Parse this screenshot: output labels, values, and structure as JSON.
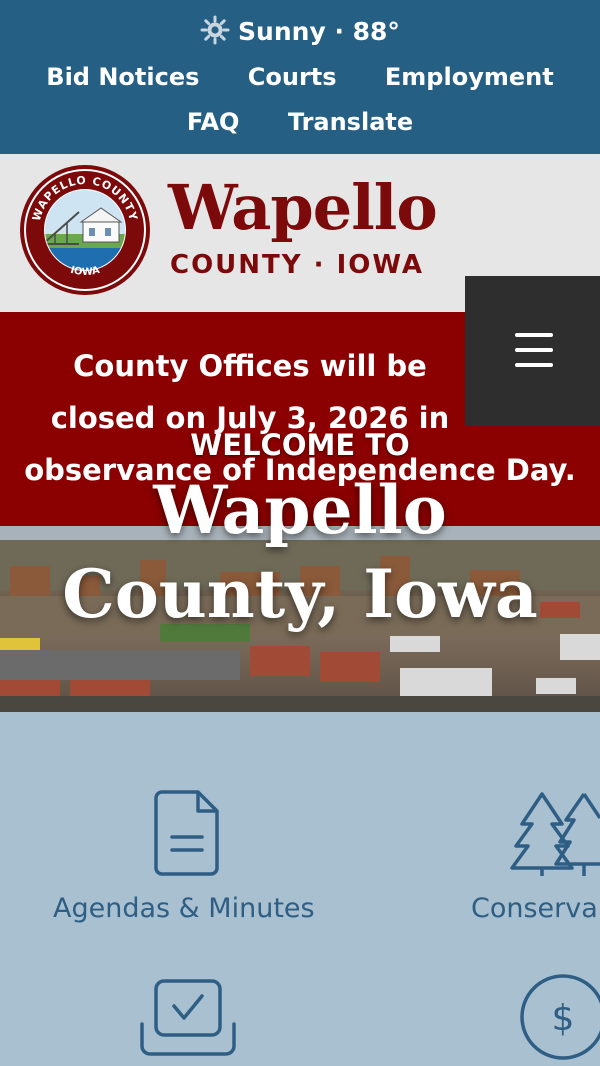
{
  "utility": {
    "weather": "Sunny · 88°",
    "weather_icon": "sun-icon",
    "links": [
      "Bid Notices",
      "Courts",
      "Employment",
      "FAQ",
      "Translate"
    ]
  },
  "brand": {
    "seal_top_text": "WAPELLO COUNTY",
    "seal_bottom_text": "IOWA",
    "name": "Wapello",
    "subtitle": "COUNTY · IOWA"
  },
  "menu": {
    "icon": "hamburger-menu-icon"
  },
  "alert": {
    "line1": "County Offices will be",
    "line2": "closed on July 3, 2026 in",
    "line3": "observance of Independence Day."
  },
  "hero": {
    "kicker": "WELCOME TO",
    "title_line1": "Wapello",
    "title_line2": "County, Iowa"
  },
  "quick_links": [
    {
      "label": "Agendas & Minutes",
      "icon": "document-icon"
    },
    {
      "label": "Conserva",
      "icon": "pine-trees-icon"
    },
    {
      "label": "",
      "icon": "checkbox-tray-icon"
    },
    {
      "label": "",
      "icon": "dollar-circle-icon"
    }
  ],
  "colors": {
    "top_bar": "#255f84",
    "brand_red": "#7d0a0a",
    "alert_red": "#8b0000",
    "menu_dark": "#2e2e2e",
    "quick_bg": "#a9c0d0",
    "quick_accent": "#2f5e85"
  }
}
